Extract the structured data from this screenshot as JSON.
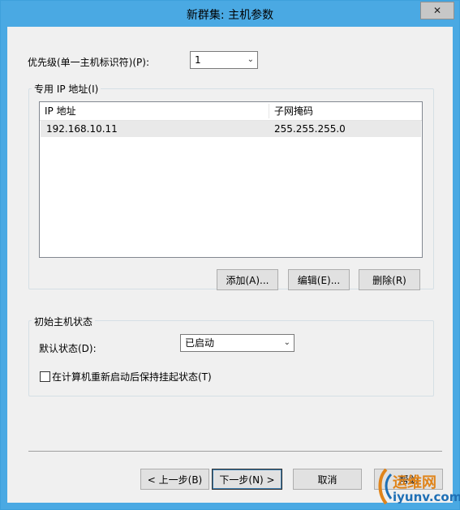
{
  "window": {
    "title": "新群集: 主机参数",
    "close_glyph": "✕"
  },
  "priority": {
    "label": "优先级(单一主机标识符)(P):",
    "value": "1"
  },
  "ip_group": {
    "title": "专用 IP 地址(I)",
    "columns": [
      "IP 地址",
      "子网掩码"
    ],
    "rows": [
      {
        "ip": "192.168.10.11",
        "mask": "255.255.255.0"
      }
    ],
    "buttons": {
      "add": "添加(A)...",
      "edit": "编辑(E)...",
      "remove": "删除(R)"
    }
  },
  "state_group": {
    "title": "初始主机状态",
    "default_state_label": "默认状态(D):",
    "default_state_value": "已启动",
    "retain_suspended_label": "在计算机重新启动后保持挂起状态(T)",
    "retain_suspended_checked": false
  },
  "footer": {
    "back": "< 上一步(B)",
    "next": "下一步(N) >",
    "cancel": "取消",
    "help": "帮助"
  },
  "watermark": {
    "brand": "运维网",
    "domain": "iyunv.com"
  },
  "colors": {
    "titlebar": "#4aa9e3",
    "dialog_bg": "#f0f0f0",
    "list_selection": "#e9e9e9"
  }
}
